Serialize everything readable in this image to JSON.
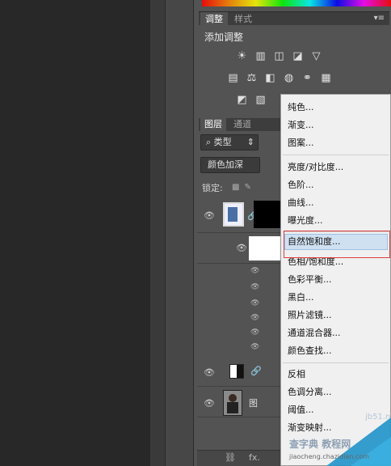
{
  "adjust_panel": {
    "tabs": [
      "调整",
      "样式"
    ],
    "heading": "添加调整",
    "icons_row1": [
      "brightness-icon",
      "levels-icon",
      "curves-icon",
      "exposure-icon",
      "vibrance-icon"
    ],
    "icons_row2": [
      "hue-saturation-icon",
      "color-balance-icon",
      "black-white-icon",
      "photo-filter-icon",
      "channel-mixer-icon",
      "color-lookup-icon"
    ],
    "icons_row3": [
      "invert-icon",
      "posterize-icon"
    ]
  },
  "layers_panel": {
    "tabs": [
      "图层",
      "通道"
    ],
    "filter_label": "类型",
    "blend_mode": "颜色加深",
    "lock_label": "锁定:",
    "bottom_layer_label": "图"
  },
  "context_menu": {
    "items": [
      "纯色...",
      "渐变...",
      "图案...",
      "亮度/对比度...",
      "色阶...",
      "曲线...",
      "曝光度...",
      "自然饱和度...",
      "色相/饱和度...",
      "色彩平衡...",
      "黑白...",
      "照片滤镜...",
      "通道混合器...",
      "颜色查找...",
      "反相",
      "色调分离...",
      "阈值...",
      "渐变映射..."
    ],
    "highlighted": "自然饱和度..."
  },
  "bottom_bar": {
    "fx_label": "fx."
  },
  "watermark": {
    "site": "jb51.net",
    "name": "教程网",
    "url": "jiaocheng.chazidian.com",
    "brand": "查字典"
  },
  "colors": {
    "panel_bg": "#535353",
    "menu_bg": "#f0f0f0",
    "highlight": "#cfe0f1",
    "red_box": "#e23b3b"
  }
}
